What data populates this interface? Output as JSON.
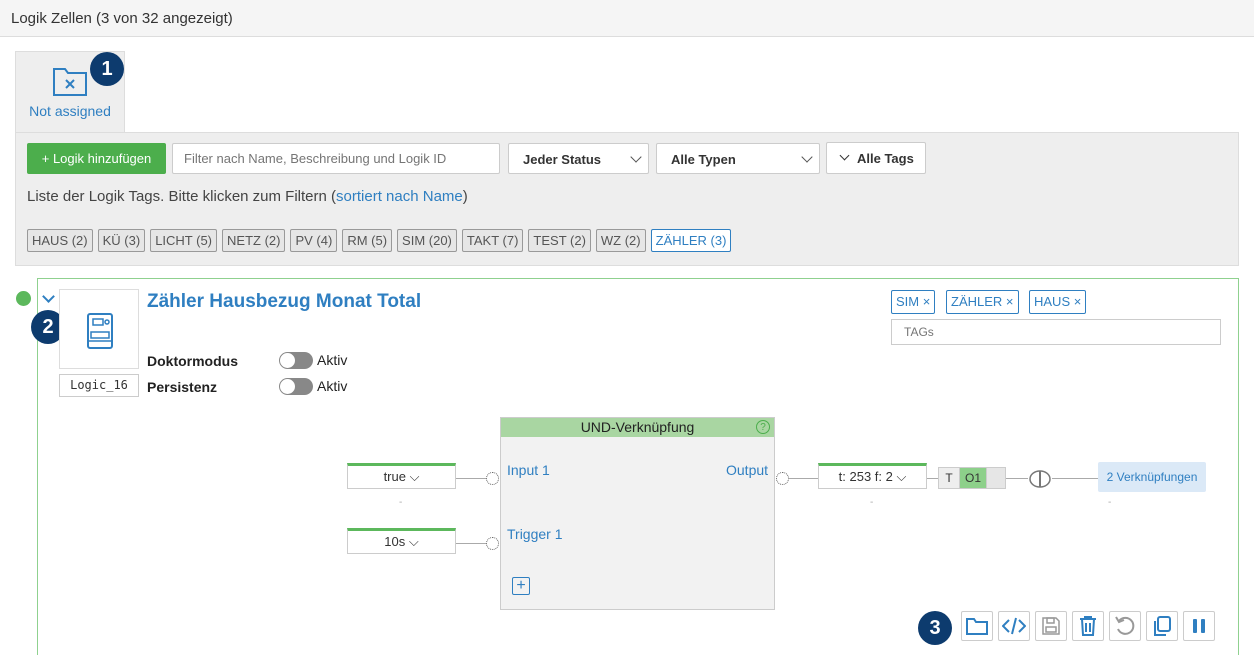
{
  "header": {
    "title": "Logik Zellen (3 von 32 angezeigt)"
  },
  "folder": {
    "label": "Not assigned",
    "icon": "folder-x-icon"
  },
  "callouts": [
    "1",
    "2",
    "3"
  ],
  "filters": {
    "add_button": "+ Logik hinzufügen",
    "search_placeholder": "Filter nach Name, Beschreibung und Logik ID",
    "status_select": "Jeder Status",
    "type_select": "Alle Typen",
    "tags_dropdown": "Alle Tags"
  },
  "taglist": {
    "text_before": "Liste der Logik Tags. Bitte klicken zum Filtern (",
    "link": "sortiert nach Name",
    "text_after": ")",
    "tags": [
      "HAUS (2)",
      "KÜ (3)",
      "LICHT (5)",
      "NETZ (2)",
      "PV (4)",
      "RM (5)",
      "SIM (20)",
      "TAKT (7)",
      "TEST (2)",
      "WZ (2)",
      "ZÄHLER (3)"
    ],
    "active_index": 10
  },
  "logic": {
    "title": "Zähler Hausbezug Monat Total",
    "id": "Logic_16",
    "options": [
      {
        "label": "Doktormodus",
        "state": "Aktiv"
      },
      {
        "label": "Persistenz",
        "state": "Aktiv"
      }
    ],
    "tags": [
      "SIM ×",
      "ZÄHLER ×",
      "HAUS ×"
    ],
    "tags_placeholder": "TAGs",
    "colors": {
      "accent": "#2f7fc1",
      "green": "#5cb85c",
      "badge": "#0d3b6e"
    }
  },
  "block": {
    "title": "UND-Verknüpfung",
    "help": "?",
    "inputs": [
      {
        "label": "Input 1",
        "value": "true ⌵",
        "below": "-"
      },
      {
        "label": "Trigger 1",
        "value": "10s ⌵",
        "below": ""
      }
    ],
    "output": {
      "label": "Output",
      "value": "t: 253 f: 2 ⌵",
      "below": "-",
      "flag_t": "T",
      "flag_o": "O1",
      "links": "2 Verknüpfungen",
      "links_below": "-"
    },
    "add": "+"
  },
  "actions": [
    "folder-icon",
    "code-icon",
    "save-icon",
    "trash-icon",
    "undo-icon",
    "copy-icon",
    "pause-icon"
  ]
}
